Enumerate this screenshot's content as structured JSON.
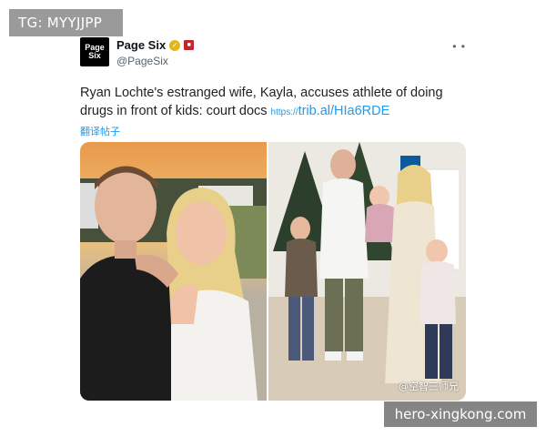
{
  "overlays": {
    "top_left_tag": "TG: MYYJJPP",
    "bottom_right_site": "hero-xingkong.com"
  },
  "tweet": {
    "avatar_text_line1": "Page",
    "avatar_text_line2": "Six",
    "display_name": "Page Six",
    "handle": "@PageSix",
    "more_icon": "• •",
    "text": "Ryan Lochte's estranged wife, Kayla, accuses athlete of doing drugs in front of kids: court docs",
    "link_prefix": "https://",
    "link": "trib.al/HIa6RDE",
    "translate_label": "翻译帖子",
    "media_watermark": "@空智三师兄"
  },
  "colors": {
    "link_blue": "#1d9bf0",
    "verified_gold": "#e2b719",
    "brand_red": "#c0262d"
  }
}
